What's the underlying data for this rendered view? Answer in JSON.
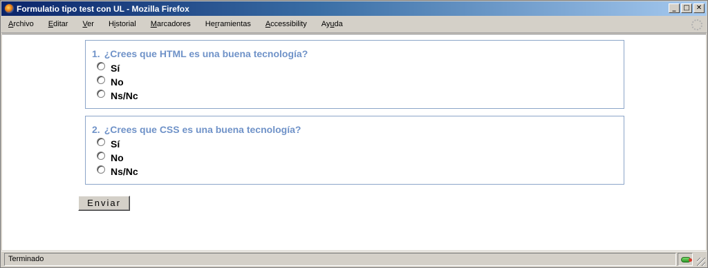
{
  "window": {
    "title": "Formulatio tipo test con UL - Mozilla Firefox"
  },
  "window_buttons": [
    "_",
    "□",
    "✕"
  ],
  "menu": [
    {
      "label": "Archivo",
      "mnemonic": "A",
      "rest": "rchivo"
    },
    {
      "label": "Editar",
      "mnemonic": "E",
      "rest": "ditar"
    },
    {
      "label": "Ver",
      "mnemonic": "V",
      "rest": "er"
    },
    {
      "label": "Historial",
      "mnemonic": "H",
      "rest": "istorial"
    },
    {
      "label": "Marcadores",
      "mnemonic": "M",
      "rest": "arcadores"
    },
    {
      "label": "Herramientas",
      "mnemonic": "H",
      "rest": "erramientas"
    },
    {
      "label": "Accessibility",
      "mnemonic": "A",
      "rest": "ccessibility"
    },
    {
      "label": "Ayuda",
      "mnemonic": "A",
      "rest": "yuda"
    }
  ],
  "questions": [
    {
      "number": "1.",
      "text": "¿Crees que HTML es una buena tecnología?",
      "options": [
        "Sí",
        "No",
        "Ns/Nc"
      ]
    },
    {
      "number": "2.",
      "text": "¿Crees que CSS es una buena tecnología?",
      "options": [
        "Sí",
        "No",
        "Ns/Nc"
      ]
    }
  ],
  "submit_label": "Enviar",
  "status": {
    "text": "Terminado"
  },
  "colors": {
    "legend": "#6f92c8",
    "border": "#8aa4c8",
    "titlebar": "#0a246a"
  },
  "icons": {
    "app": "firefox-icon",
    "throbber": "throbber-icon",
    "status": "connection-status-icon"
  }
}
